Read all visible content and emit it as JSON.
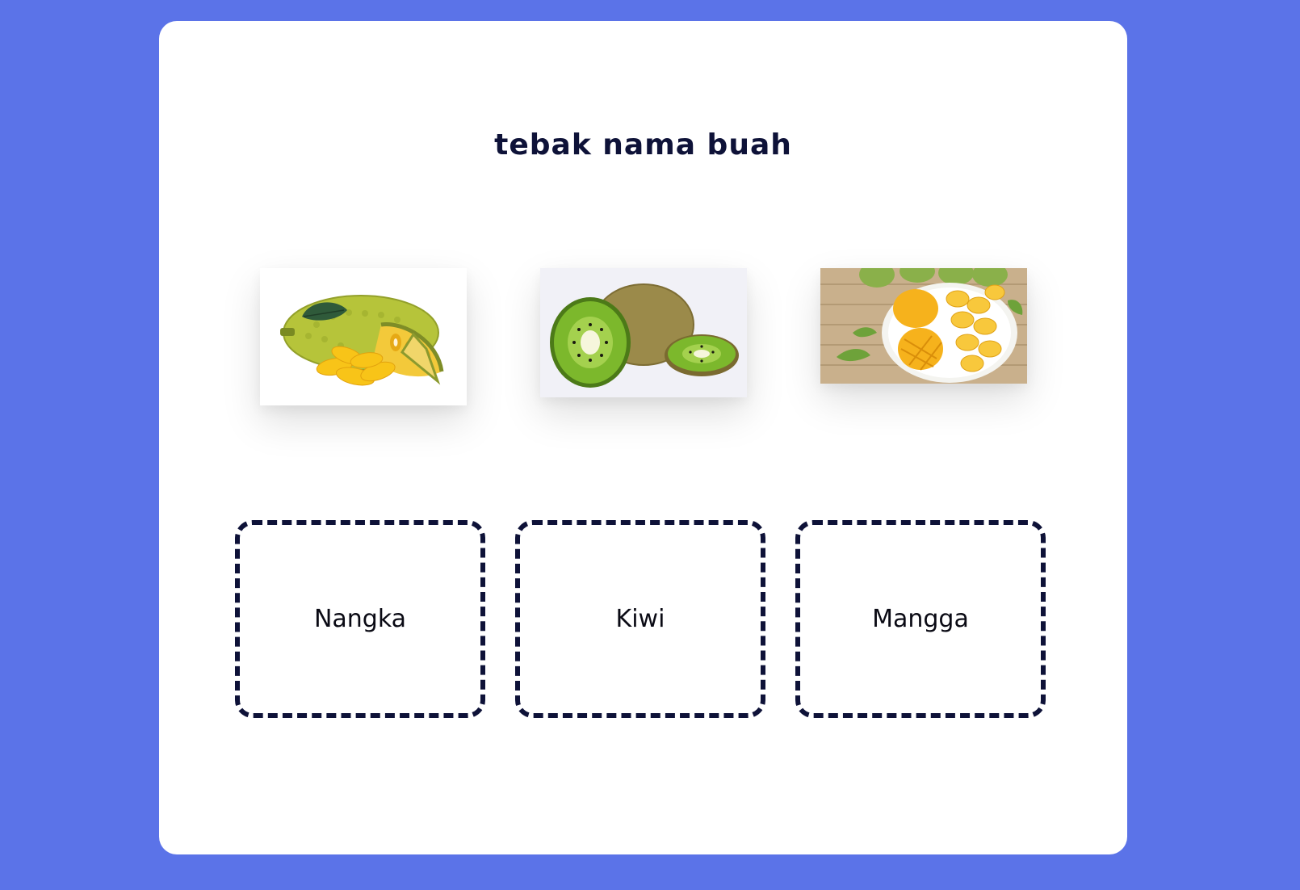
{
  "page": {
    "title": "tebak nama buah",
    "colors": {
      "background": "#5b73e8",
      "card": "#ffffff",
      "text_dark": "#0e1238",
      "dashed_border": "#0e1238"
    }
  },
  "images": [
    {
      "fruit": "jackfruit",
      "icon": "jackfruit-image"
    },
    {
      "fruit": "kiwi",
      "icon": "kiwi-image"
    },
    {
      "fruit": "mango",
      "icon": "mango-image"
    }
  ],
  "drop_zones": [
    {
      "label": "Nangka"
    },
    {
      "label": "Kiwi"
    },
    {
      "label": "Mangga"
    }
  ]
}
